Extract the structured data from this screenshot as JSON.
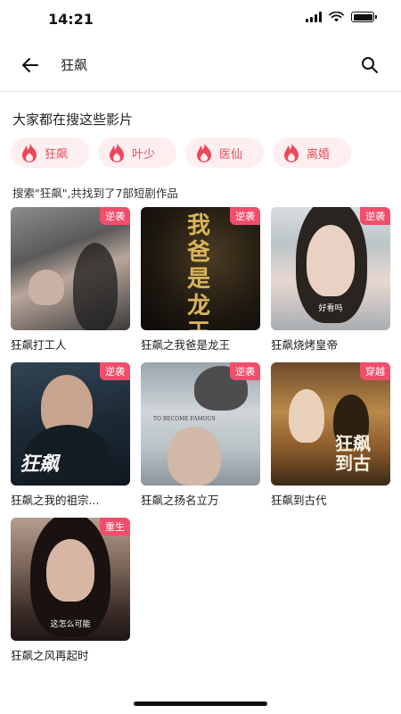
{
  "status_bar": {
    "time": "14:21"
  },
  "header": {
    "query": "狂飙"
  },
  "hot": {
    "title": "大家都在搜这些影片",
    "tags": [
      "狂飙",
      "叶少",
      "医仙",
      "离婚"
    ]
  },
  "results": {
    "summary": "搜索\"狂飙\",共找到了7部短剧作品",
    "items": [
      {
        "title": "狂飙打工人",
        "badge": "逆袭"
      },
      {
        "title": "狂飙之我爸是龙王",
        "badge": "逆袭",
        "poster_text": "我爸是龙王"
      },
      {
        "title": "狂飙烧烤皇帝",
        "badge": "逆袭",
        "caption": "好看吗"
      },
      {
        "title": "狂飙之我的祖宗...",
        "badge": "逆袭",
        "poster_text": "狂飙"
      },
      {
        "title": "狂飙之扬名立万",
        "badge": "逆袭",
        "poster_text": "TO BECOME FAMOUS"
      },
      {
        "title": "狂飙到古代",
        "badge": "穿越",
        "poster_text": "狂飙到古"
      },
      {
        "title": "狂飙之风再起时",
        "badge": "重生",
        "caption": "这怎么可能"
      }
    ]
  },
  "colors": {
    "accent": "#f04e6b",
    "tag_bg": "#fdeef0",
    "tag_text": "#e8505b"
  },
  "icons": {
    "back": "arrow-left-icon",
    "search": "search-icon",
    "hot": "flame-icon"
  }
}
